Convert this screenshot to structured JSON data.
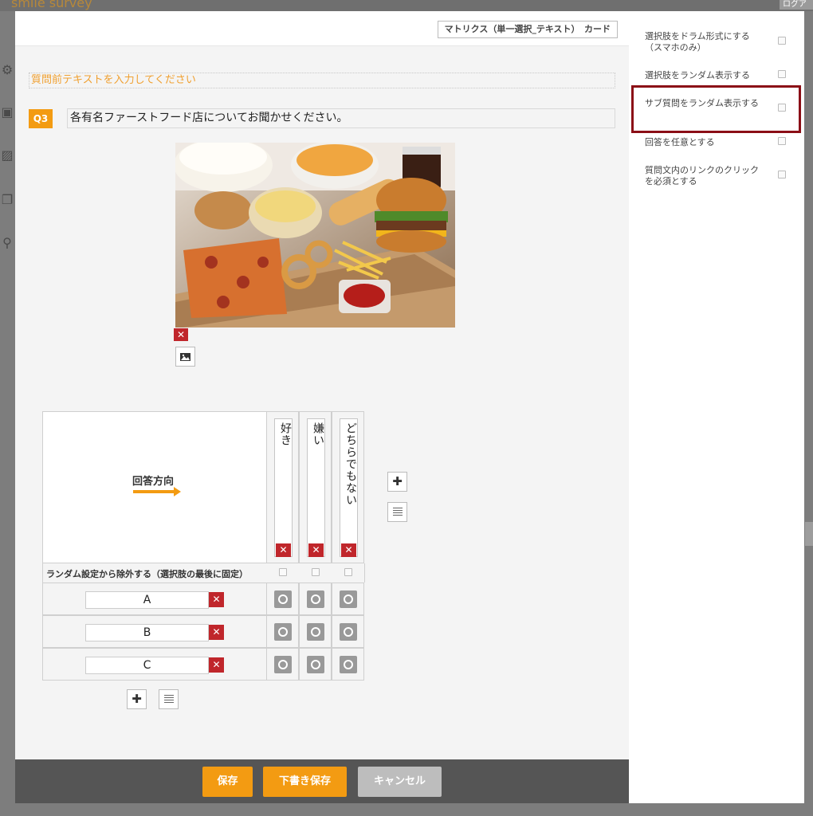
{
  "background": {
    "logo": "smile survey",
    "login": "ログア"
  },
  "modal": {
    "question_type": "マトリクス（単一選択_テキスト）　カード",
    "pre_text_placeholder": "質問前テキストを入力してください",
    "question_number": "Q3",
    "question_text": "各有名ファーストフード店についてお聞かせください。",
    "image_alt": "fast-food-photo"
  },
  "matrix": {
    "direction_label": "回答方向",
    "columns": [
      {
        "label": "好き"
      },
      {
        "label": "嫌い"
      },
      {
        "label": "どちらでもない"
      }
    ],
    "random_exclude_label": "ランダム設定から除外する（選択肢の最後に固定）",
    "rows": [
      {
        "label": "A"
      },
      {
        "label": "B"
      },
      {
        "label": "C"
      }
    ],
    "add_icon": "✚"
  },
  "footer": {
    "save": "保存",
    "draft_save": "下書き保存",
    "cancel": "キャンセル"
  },
  "right_panel": {
    "options": [
      {
        "label": "選択肢をドラム形式にする（スマホのみ）"
      },
      {
        "label": "選択肢をランダム表示する"
      },
      {
        "label": "サブ質問をランダム表示する"
      },
      {
        "label": "回答を任意とする"
      },
      {
        "label": "質問文内のリンクのクリックを必須とする"
      }
    ],
    "highlight_color": "#8b0e16"
  },
  "colors": {
    "accent": "#f39b12",
    "delete": "#c0262b"
  }
}
